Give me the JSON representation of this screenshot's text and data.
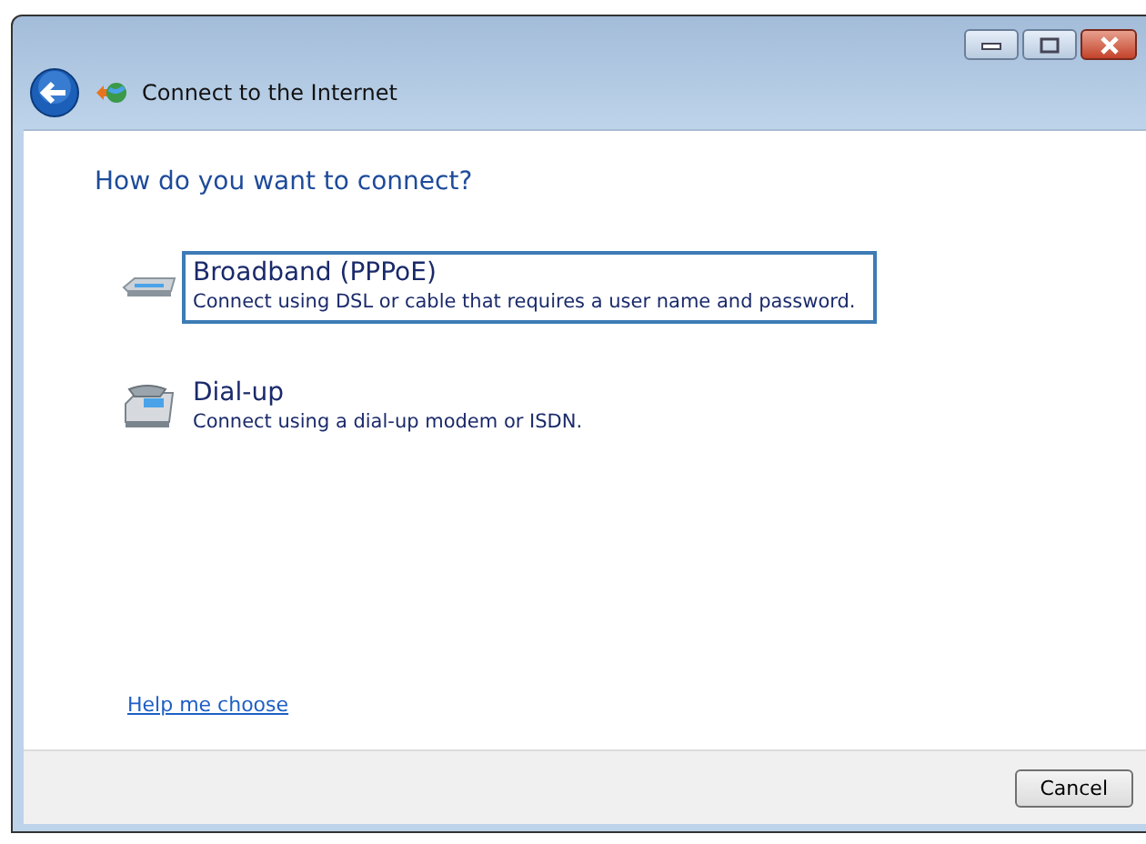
{
  "window": {
    "title": "Connect to the Internet"
  },
  "heading": "How do you want to connect?",
  "options": [
    {
      "kind": "broadband",
      "title": "Broadband (PPPoE)",
      "description": "Connect using DSL or cable that requires a user name and password.",
      "selected": true
    },
    {
      "kind": "dialup",
      "title": "Dial-up",
      "description": "Connect using a dial-up modem or ISDN.",
      "selected": false
    }
  ],
  "help_link": "Help me choose",
  "buttons": [
    "Cancel"
  ]
}
